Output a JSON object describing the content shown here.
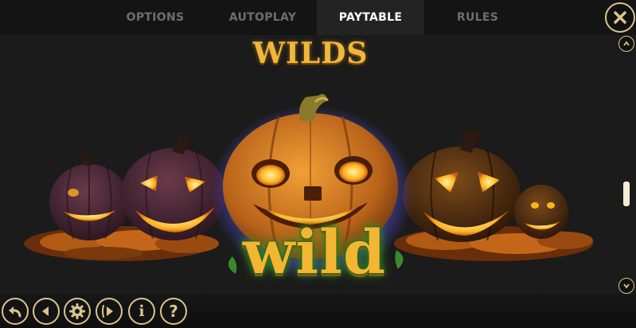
{
  "tabs": {
    "options": "OPTIONS",
    "autoplay": "AUTOPLAY",
    "paytable": "PAYTABLE",
    "rules": "RULES",
    "active": "PAYTABLE"
  },
  "section": {
    "title": "WILDS",
    "symbol_label": "wild"
  },
  "icons": {
    "close": "close-icon",
    "scroll_up": "chevron-up-icon",
    "scroll_down": "chevron-down-icon",
    "toolbar": [
      "back-arrow-icon",
      "previous-icon",
      "settings-gear-icon",
      "next-icon",
      "info-icon",
      "help-icon"
    ]
  },
  "toolbar": {
    "info_glyph": "i",
    "help_glyph": "?"
  },
  "colors": {
    "accent_gold": "#d8c48e",
    "title_gold": "#f0b73a",
    "active_tab_bg": "#232323",
    "inactive_tab_text": "#6e6e6e",
    "background": "#1b1b1b"
  }
}
